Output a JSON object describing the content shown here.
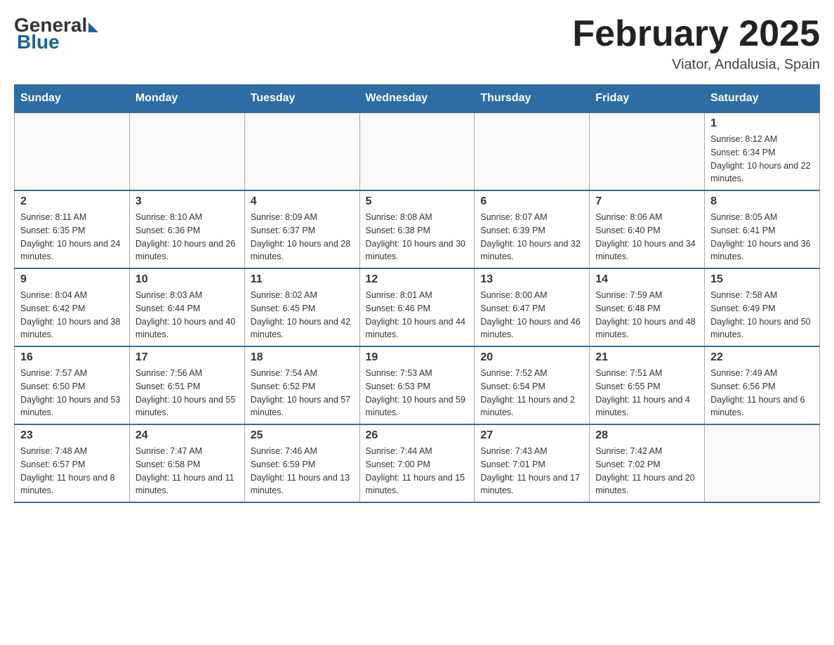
{
  "header": {
    "logo": {
      "general": "General",
      "blue": "Blue"
    },
    "title": "February 2025",
    "location": "Viator, Andalusia, Spain"
  },
  "days_of_week": [
    "Sunday",
    "Monday",
    "Tuesday",
    "Wednesday",
    "Thursday",
    "Friday",
    "Saturday"
  ],
  "weeks": [
    {
      "days": [
        {
          "number": "",
          "info": ""
        },
        {
          "number": "",
          "info": ""
        },
        {
          "number": "",
          "info": ""
        },
        {
          "number": "",
          "info": ""
        },
        {
          "number": "",
          "info": ""
        },
        {
          "number": "",
          "info": ""
        },
        {
          "number": "1",
          "info": "Sunrise: 8:12 AM\nSunset: 6:34 PM\nDaylight: 10 hours and 22 minutes."
        }
      ]
    },
    {
      "days": [
        {
          "number": "2",
          "info": "Sunrise: 8:11 AM\nSunset: 6:35 PM\nDaylight: 10 hours and 24 minutes."
        },
        {
          "number": "3",
          "info": "Sunrise: 8:10 AM\nSunset: 6:36 PM\nDaylight: 10 hours and 26 minutes."
        },
        {
          "number": "4",
          "info": "Sunrise: 8:09 AM\nSunset: 6:37 PM\nDaylight: 10 hours and 28 minutes."
        },
        {
          "number": "5",
          "info": "Sunrise: 8:08 AM\nSunset: 6:38 PM\nDaylight: 10 hours and 30 minutes."
        },
        {
          "number": "6",
          "info": "Sunrise: 8:07 AM\nSunset: 6:39 PM\nDaylight: 10 hours and 32 minutes."
        },
        {
          "number": "7",
          "info": "Sunrise: 8:06 AM\nSunset: 6:40 PM\nDaylight: 10 hours and 34 minutes."
        },
        {
          "number": "8",
          "info": "Sunrise: 8:05 AM\nSunset: 6:41 PM\nDaylight: 10 hours and 36 minutes."
        }
      ]
    },
    {
      "days": [
        {
          "number": "9",
          "info": "Sunrise: 8:04 AM\nSunset: 6:42 PM\nDaylight: 10 hours and 38 minutes."
        },
        {
          "number": "10",
          "info": "Sunrise: 8:03 AM\nSunset: 6:44 PM\nDaylight: 10 hours and 40 minutes."
        },
        {
          "number": "11",
          "info": "Sunrise: 8:02 AM\nSunset: 6:45 PM\nDaylight: 10 hours and 42 minutes."
        },
        {
          "number": "12",
          "info": "Sunrise: 8:01 AM\nSunset: 6:46 PM\nDaylight: 10 hours and 44 minutes."
        },
        {
          "number": "13",
          "info": "Sunrise: 8:00 AM\nSunset: 6:47 PM\nDaylight: 10 hours and 46 minutes."
        },
        {
          "number": "14",
          "info": "Sunrise: 7:59 AM\nSunset: 6:48 PM\nDaylight: 10 hours and 48 minutes."
        },
        {
          "number": "15",
          "info": "Sunrise: 7:58 AM\nSunset: 6:49 PM\nDaylight: 10 hours and 50 minutes."
        }
      ]
    },
    {
      "days": [
        {
          "number": "16",
          "info": "Sunrise: 7:57 AM\nSunset: 6:50 PM\nDaylight: 10 hours and 53 minutes."
        },
        {
          "number": "17",
          "info": "Sunrise: 7:56 AM\nSunset: 6:51 PM\nDaylight: 10 hours and 55 minutes."
        },
        {
          "number": "18",
          "info": "Sunrise: 7:54 AM\nSunset: 6:52 PM\nDaylight: 10 hours and 57 minutes."
        },
        {
          "number": "19",
          "info": "Sunrise: 7:53 AM\nSunset: 6:53 PM\nDaylight: 10 hours and 59 minutes."
        },
        {
          "number": "20",
          "info": "Sunrise: 7:52 AM\nSunset: 6:54 PM\nDaylight: 11 hours and 2 minutes."
        },
        {
          "number": "21",
          "info": "Sunrise: 7:51 AM\nSunset: 6:55 PM\nDaylight: 11 hours and 4 minutes."
        },
        {
          "number": "22",
          "info": "Sunrise: 7:49 AM\nSunset: 6:56 PM\nDaylight: 11 hours and 6 minutes."
        }
      ]
    },
    {
      "days": [
        {
          "number": "23",
          "info": "Sunrise: 7:48 AM\nSunset: 6:57 PM\nDaylight: 11 hours and 8 minutes."
        },
        {
          "number": "24",
          "info": "Sunrise: 7:47 AM\nSunset: 6:58 PM\nDaylight: 11 hours and 11 minutes."
        },
        {
          "number": "25",
          "info": "Sunrise: 7:46 AM\nSunset: 6:59 PM\nDaylight: 11 hours and 13 minutes."
        },
        {
          "number": "26",
          "info": "Sunrise: 7:44 AM\nSunset: 7:00 PM\nDaylight: 11 hours and 15 minutes."
        },
        {
          "number": "27",
          "info": "Sunrise: 7:43 AM\nSunset: 7:01 PM\nDaylight: 11 hours and 17 minutes."
        },
        {
          "number": "28",
          "info": "Sunrise: 7:42 AM\nSunset: 7:02 PM\nDaylight: 11 hours and 20 minutes."
        },
        {
          "number": "",
          "info": ""
        }
      ]
    }
  ]
}
